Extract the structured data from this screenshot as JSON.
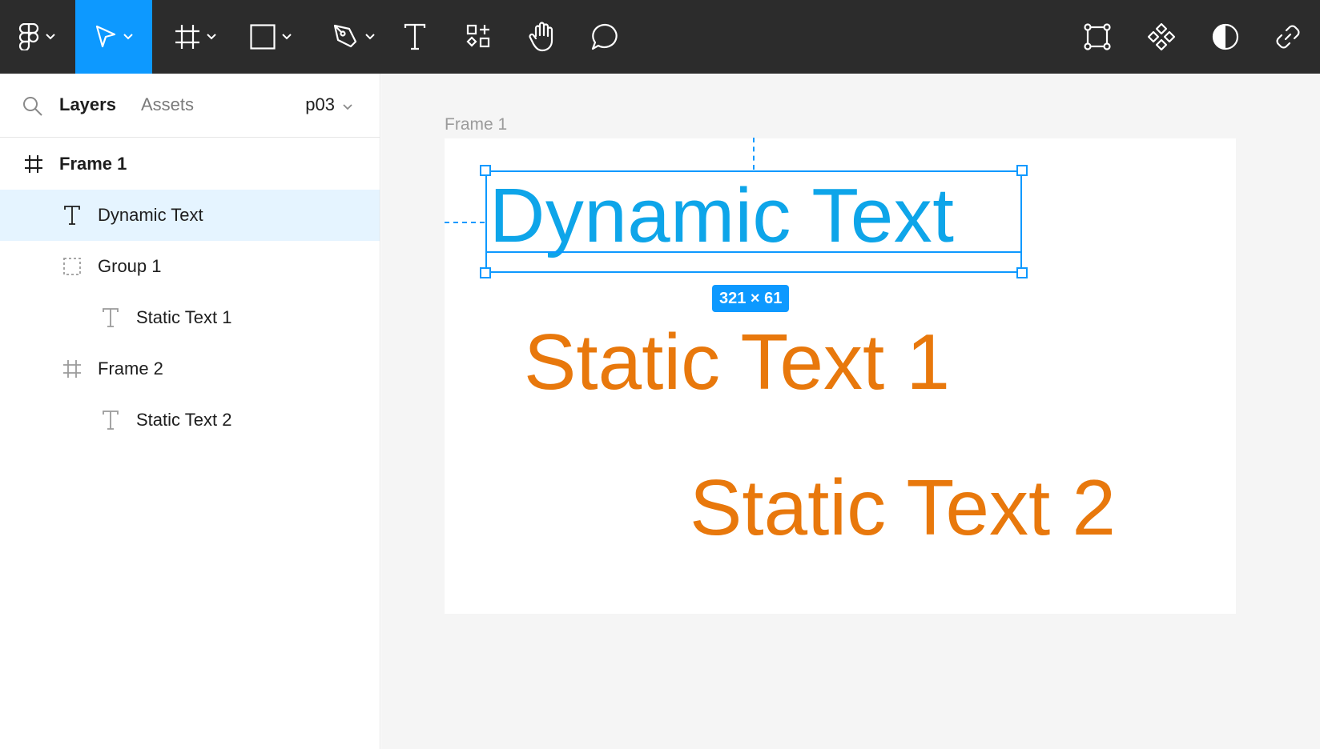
{
  "toolbar": {
    "tools": [
      {
        "name": "main-menu",
        "icon": "figma-logo-icon"
      },
      {
        "name": "move-tool",
        "icon": "cursor-arrow-icon",
        "active": true
      },
      {
        "name": "frame-tool",
        "icon": "frame-hash-icon"
      },
      {
        "name": "shape-tool",
        "icon": "rectangle-icon"
      },
      {
        "name": "pen-tool",
        "icon": "pen-nib-icon"
      },
      {
        "name": "text-tool",
        "icon": "text-t-icon"
      },
      {
        "name": "resources-tool",
        "icon": "resources-shapes-icon"
      },
      {
        "name": "hand-tool",
        "icon": "hand-icon"
      },
      {
        "name": "comment-tool",
        "icon": "speech-bubble-icon"
      },
      {
        "name": "edit-object",
        "icon": "vector-edit-icon"
      },
      {
        "name": "components",
        "icon": "component-diamond-icon"
      },
      {
        "name": "contrast",
        "icon": "half-circle-contrast-icon"
      },
      {
        "name": "link",
        "icon": "link-chain-icon"
      }
    ],
    "active_color": "#0d99ff"
  },
  "left_panel": {
    "tabs": {
      "layers": "Layers",
      "assets": "Assets"
    },
    "page": "p03",
    "layers": [
      {
        "name": "Frame 1",
        "icon": "frame-hash-icon",
        "depth": 0,
        "bold": true,
        "selected": false
      },
      {
        "name": "Dynamic Text",
        "icon": "text-t-icon",
        "depth": 1,
        "bold": false,
        "selected": true
      },
      {
        "name": "Group 1",
        "icon": "group-dashed-icon",
        "depth": 1,
        "bold": false,
        "selected": false
      },
      {
        "name": "Static Text 1",
        "icon": "text-t-icon",
        "depth": 2,
        "bold": false,
        "selected": false
      },
      {
        "name": "Frame 2",
        "icon": "frame-hash-icon",
        "depth": 1,
        "bold": false,
        "selected": false
      },
      {
        "name": "Static Text 2",
        "icon": "text-t-icon",
        "depth": 2,
        "bold": false,
        "selected": false
      }
    ]
  },
  "canvas": {
    "frame_label": "Frame 1",
    "dynamic_text": "Dynamic Text",
    "static_text_1": "Static Text 1",
    "static_text_2": "Static Text 2",
    "selection_size": "321 × 61",
    "dynamic_color": "#0ea5e9",
    "static_color": "#e8780c"
  }
}
